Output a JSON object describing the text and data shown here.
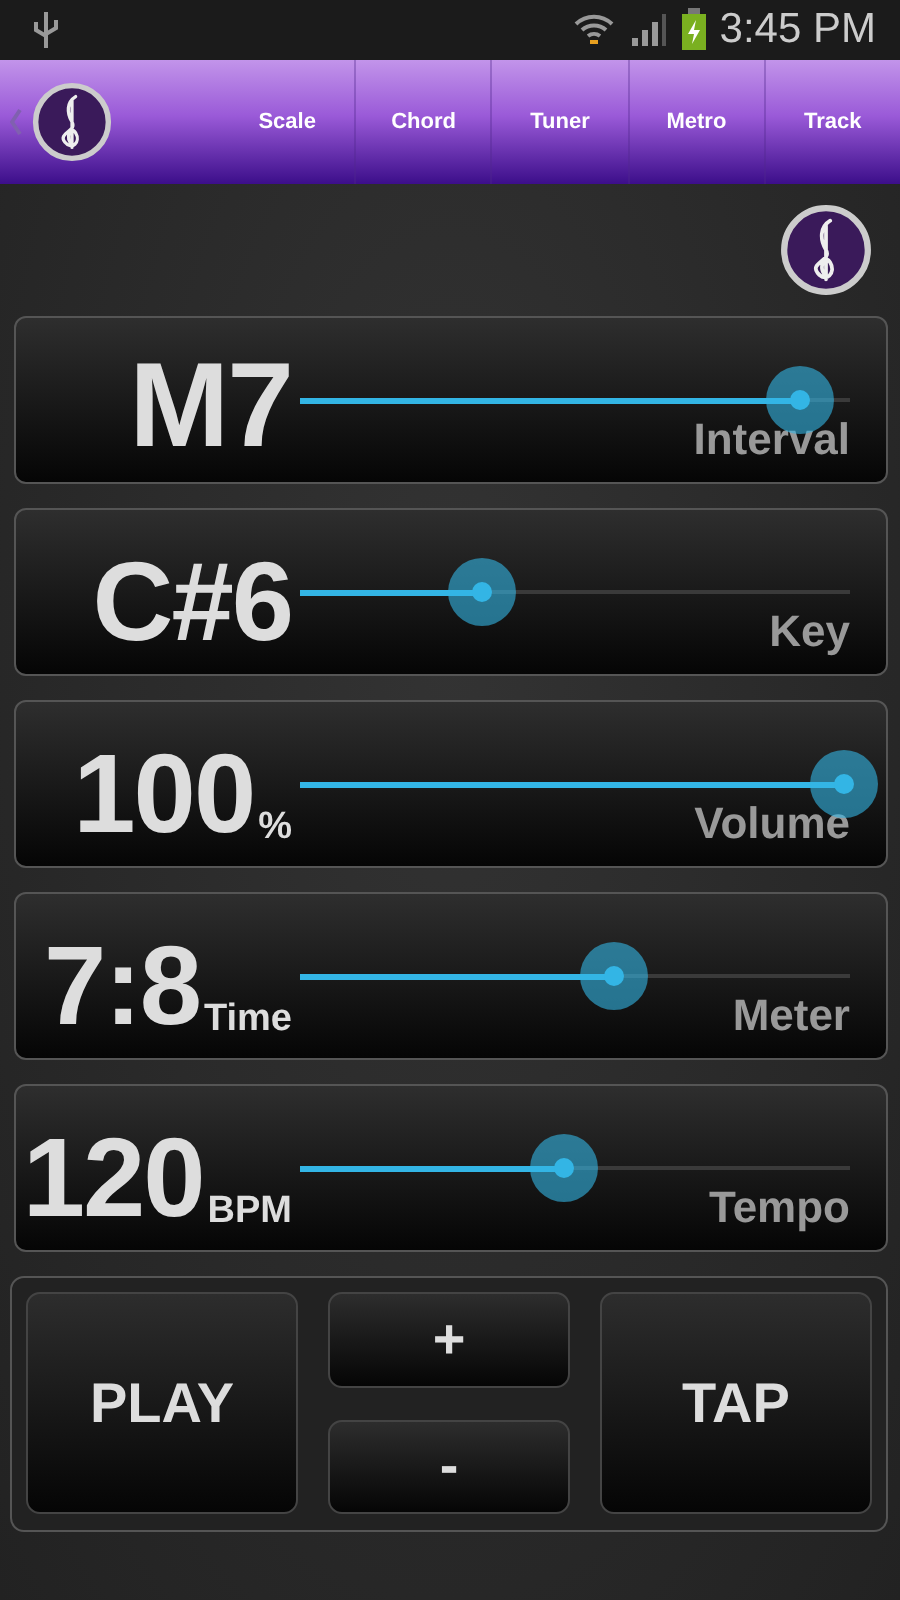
{
  "status_bar": {
    "time": "3:45 PM"
  },
  "nav": {
    "tabs": [
      {
        "label": "Scale",
        "selected": false
      },
      {
        "label": "Chord",
        "selected": false
      },
      {
        "label": "Tuner",
        "selected": false
      },
      {
        "label": "Metro",
        "selected": false
      },
      {
        "label": "Track",
        "selected": false
      }
    ]
  },
  "params": [
    {
      "value": "M7",
      "label": "Interval",
      "level": 0.91
    },
    {
      "value": "C#6",
      "label": "Key",
      "level": 0.33
    },
    {
      "value": "100",
      "unit": "%",
      "label": "Volume",
      "level": 0.99
    },
    {
      "value": "7:8",
      "unit": "Time",
      "label": "Meter",
      "level": 0.57
    },
    {
      "value": "120",
      "unit": "BPM",
      "label": "Tempo",
      "level": 0.48
    }
  ],
  "controls": {
    "play": "PLAY",
    "plus": "+",
    "minus": "-",
    "tap": "TAP"
  }
}
